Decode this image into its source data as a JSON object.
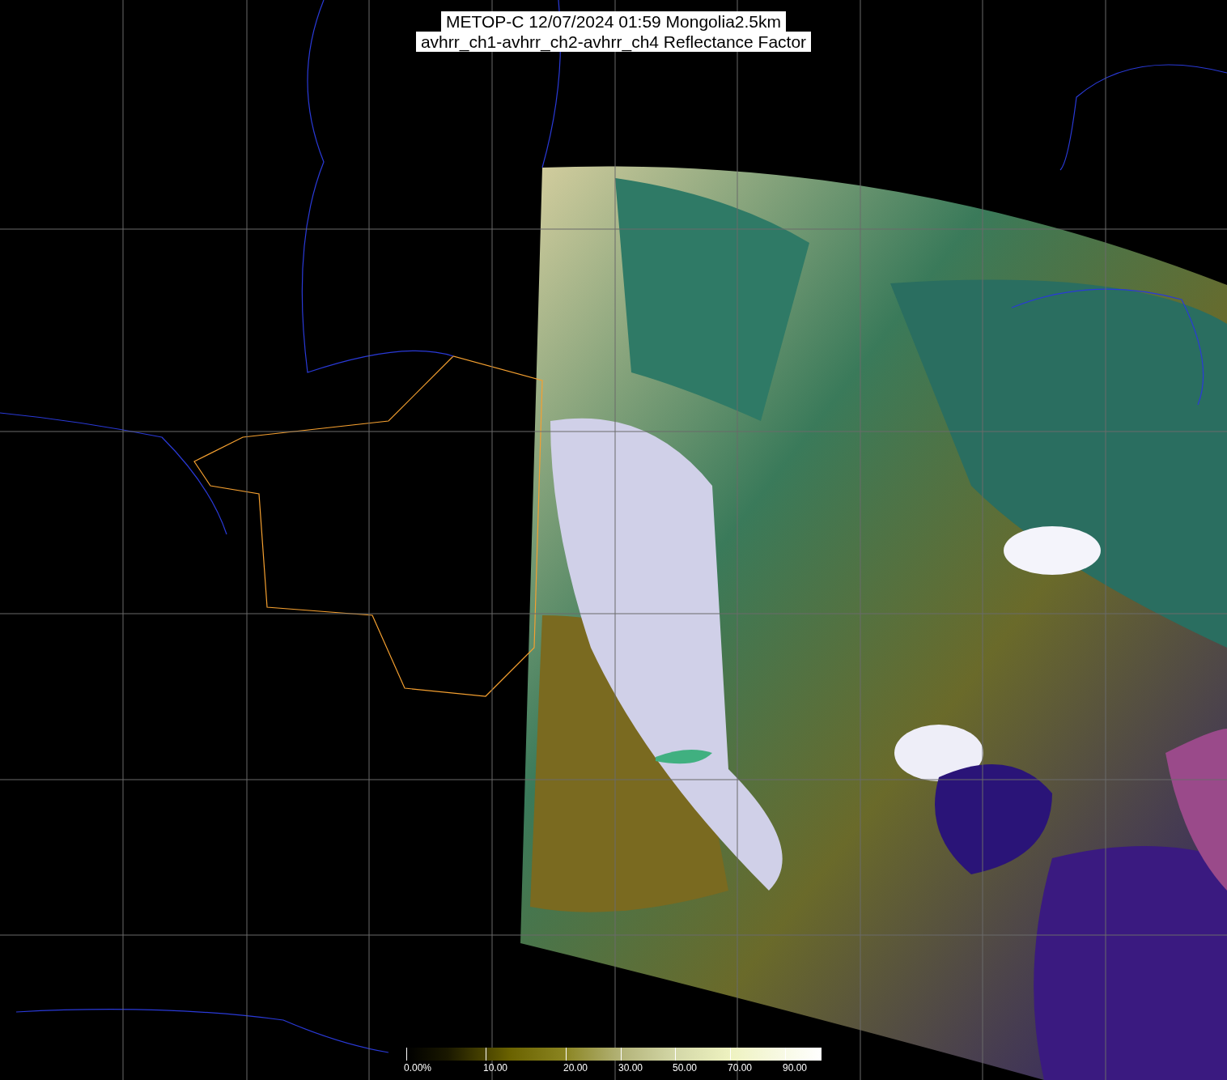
{
  "title": {
    "lines": [
      "METOP-C 12/07/2024 01:59 Mongolia2.5km",
      "avhrr_ch1-avhrr_ch2-avhrr_ch4 Reflectance Factor"
    ]
  },
  "colorbar": {
    "labels": [
      "0.00%",
      "10.00",
      "20.00",
      "30.00",
      "50.00",
      "70.00",
      "90.00"
    ]
  }
}
